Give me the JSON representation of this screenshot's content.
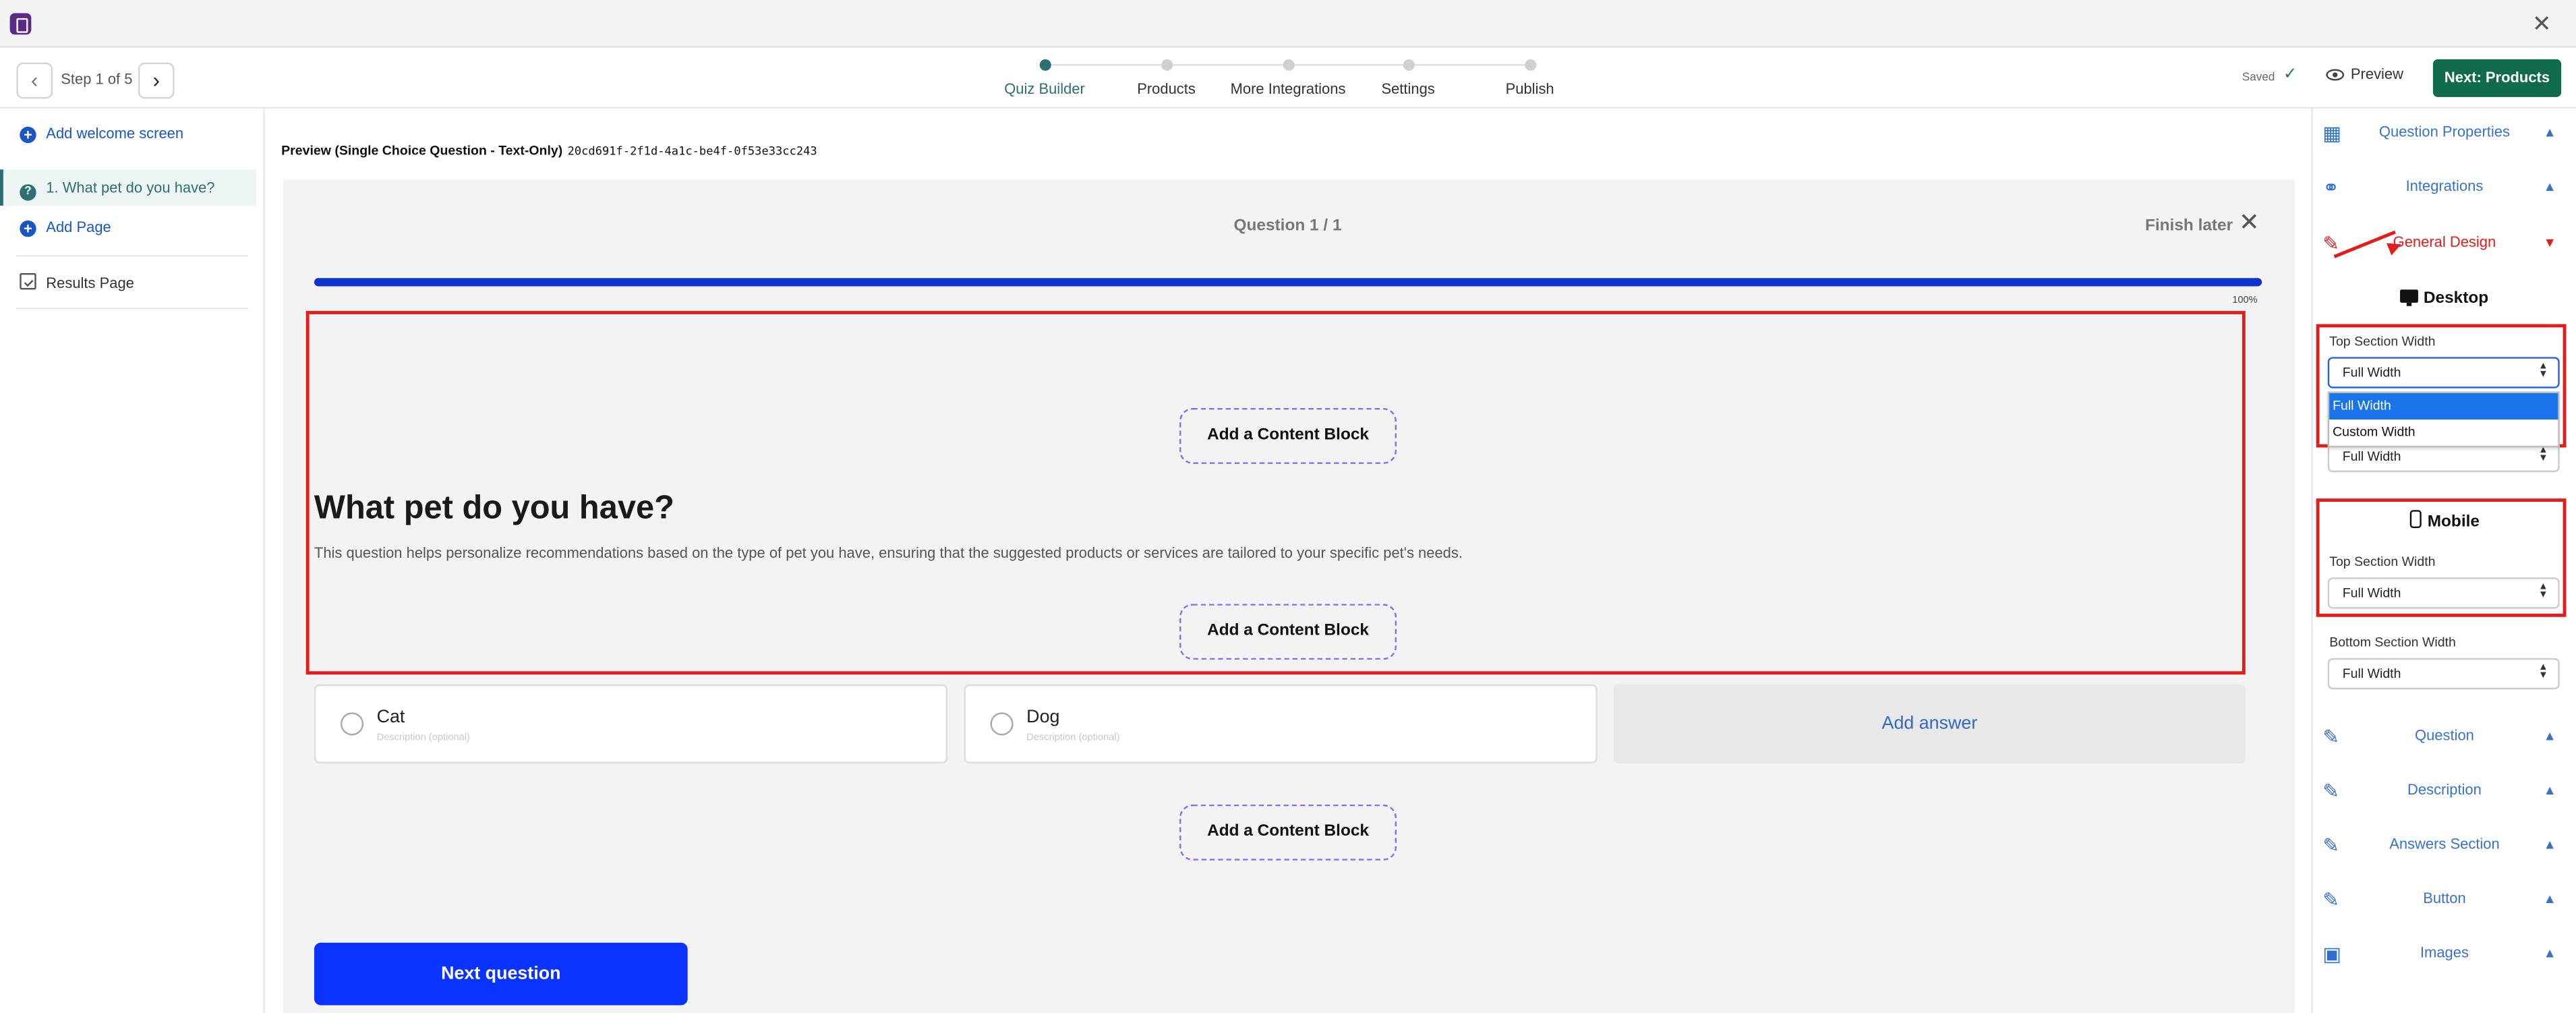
{
  "topnav": {
    "step_text": "Step 1 of 5",
    "steps": [
      {
        "label": "Quiz Builder",
        "active": true
      },
      {
        "label": "Products",
        "active": false
      },
      {
        "label": "More Integrations",
        "active": false
      },
      {
        "label": "Settings",
        "active": false
      },
      {
        "label": "Publish",
        "active": false
      }
    ],
    "saved": "Saved",
    "preview": "Preview",
    "next": "Next: Products"
  },
  "sidebar": {
    "add_welcome": "Add welcome screen",
    "question": "1. What pet do you have?",
    "add_page": "Add Page",
    "results": "Results Page"
  },
  "main": {
    "preview_title": "Preview (Single Choice Question - Text-Only)",
    "preview_id": "20cd691f-2f1d-4a1c-be4f-0f53e33cc243",
    "question_count": "Question 1 / 1",
    "finish_later": "Finish later",
    "progress_percent": 100,
    "progress_label": "100%",
    "add_content_block": "Add a Content Block",
    "heading": "What pet do you have?",
    "description": "This question helps personalize recommendations based on the type of pet you have, ensuring that the suggested products or services are tailored to your specific pet's needs.",
    "answers": [
      {
        "label": "Cat",
        "description": "Description (optional)"
      },
      {
        "label": "Dog",
        "description": "Description (optional)"
      }
    ],
    "add_answer": "Add answer",
    "next_question": "Next question"
  },
  "right_panel": {
    "question_properties": "Question Properties",
    "integrations": "Integrations",
    "general_design": "General Design",
    "desktop": "Desktop",
    "desktop_top_label": "Top Section Width",
    "desktop_top_value": "Full Width",
    "desktop_bottom_value": "Full Width",
    "dropdown_options": [
      "Full Width",
      "Custom Width"
    ],
    "mobile": "Mobile",
    "mobile_top_label": "Top Section Width",
    "mobile_top_value": "Full Width",
    "mobile_bottom_label": "Bottom Section Width",
    "mobile_bottom_value": "Full Width",
    "sections": [
      "Question",
      "Description",
      "Answers Section",
      "Button",
      "Images"
    ]
  },
  "colors": {
    "accent_teal": "#2f6f73",
    "primary_green": "#0f6b4a",
    "progress_blue": "#1133cc",
    "next_question_blue": "#0b33ff",
    "annotation_red": "#e21d1d",
    "link_blue": "#3a72c9"
  }
}
